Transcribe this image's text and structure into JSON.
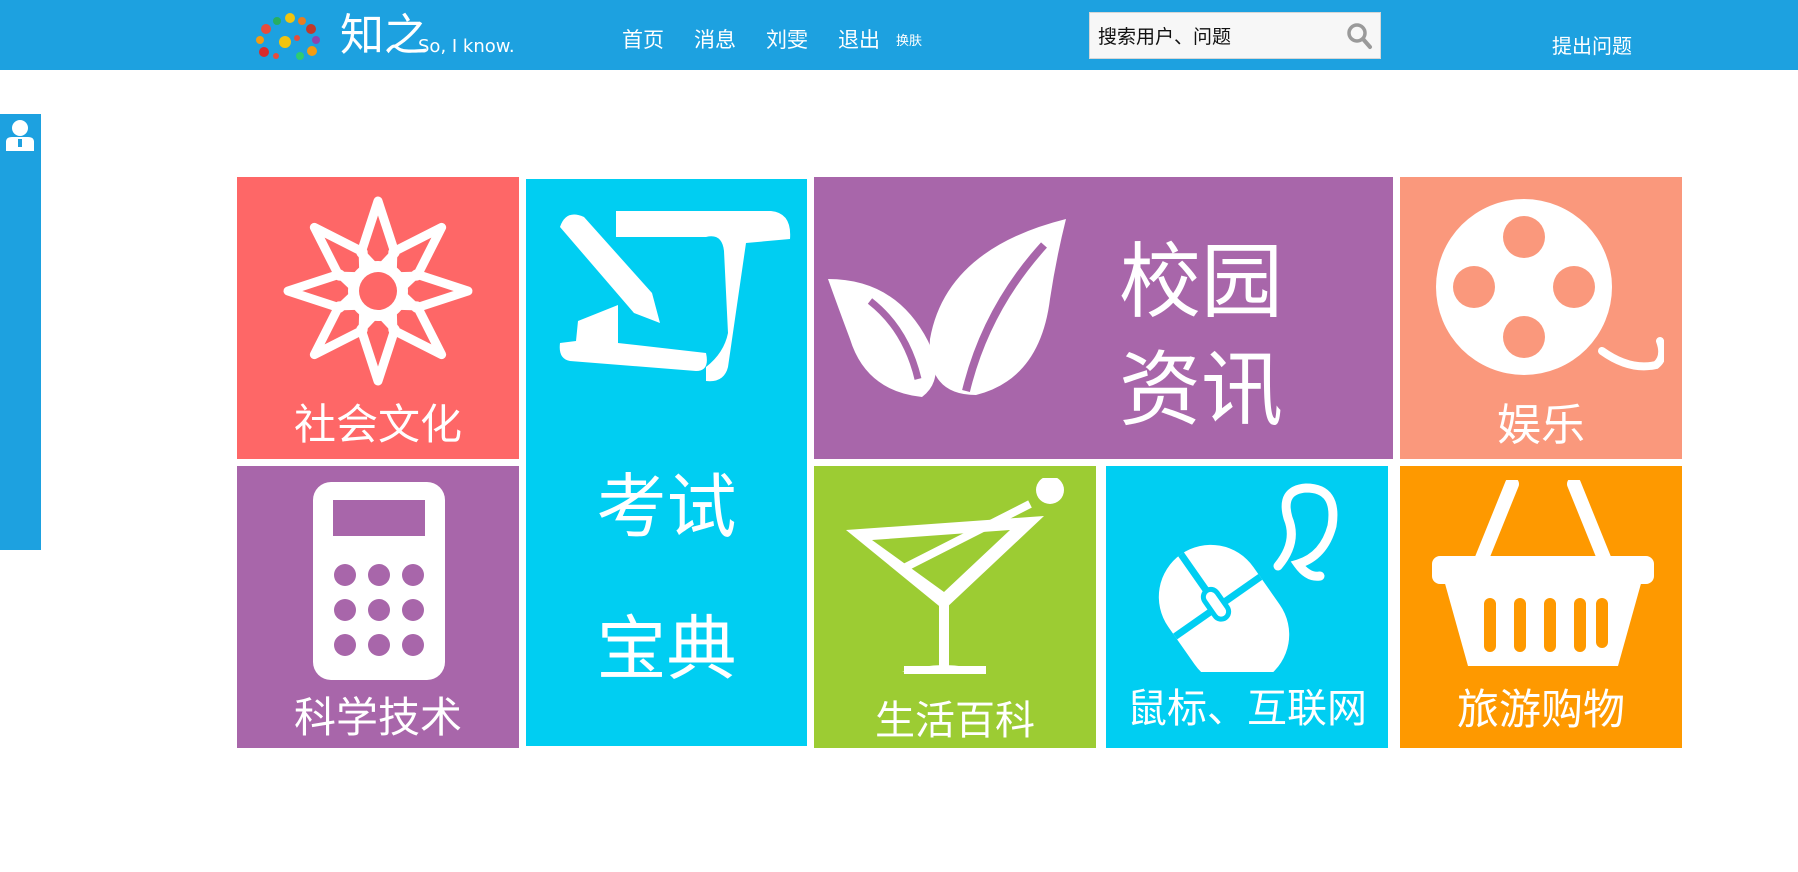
{
  "brand": {
    "name": "知之",
    "tagline": "So, I know."
  },
  "nav": {
    "items": [
      "首页",
      "消息",
      "刘雯",
      "退出"
    ],
    "skin": "换肤"
  },
  "search": {
    "placeholder": "搜索用户、问题"
  },
  "actions": {
    "ask_label": "提出问题"
  },
  "tiles": [
    {
      "label": "社会文化",
      "color": "#fe6767",
      "icon": "flower-icon"
    },
    {
      "label": "考试",
      "label2": "宝典",
      "color": "#00cef2",
      "icon": "scroll-pen-icon"
    },
    {
      "label": "校园",
      "label2": "资讯",
      "color": "#a866aa",
      "icon": "leaf-icon"
    },
    {
      "label": "娱乐",
      "color": "#fa987c",
      "icon": "film-reel-icon"
    },
    {
      "label": "科学技术",
      "color": "#a866aa",
      "icon": "calculator-icon"
    },
    {
      "label": "生活百科",
      "color": "#9ccc33",
      "icon": "cocktail-icon"
    },
    {
      "label": "鼠标、互联网",
      "color": "#00cef2",
      "icon": "mouse-icon"
    },
    {
      "label": "旅游购物",
      "color": "#fe9900",
      "icon": "basket-icon"
    }
  ]
}
